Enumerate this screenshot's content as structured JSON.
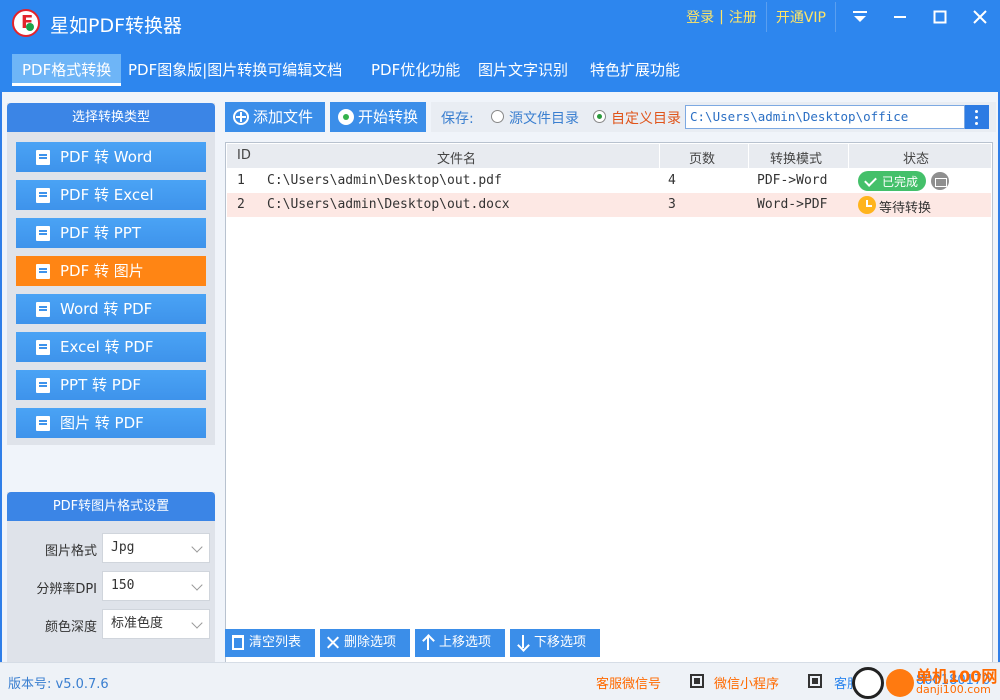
{
  "app": {
    "title": "星如PDF转换器"
  },
  "topbar": {
    "login": "登录",
    "sep": "|",
    "register": "注册",
    "vip": "开通VIP"
  },
  "menu": [
    {
      "label": "PDF格式转换",
      "active": true
    },
    {
      "label": "PDF图象版|图片转换可编辑文档",
      "active": false
    },
    {
      "label": "PDF优化功能",
      "active": false
    },
    {
      "label": "图片文字识别",
      "active": false
    },
    {
      "label": "特色扩展功能",
      "active": false
    }
  ],
  "sidebar": {
    "header": "选择转换类型",
    "items": [
      {
        "label": "PDF 转 Word",
        "selected": false
      },
      {
        "label": "PDF 转 Excel",
        "selected": false
      },
      {
        "label": "PDF 转 PPT",
        "selected": false
      },
      {
        "label": "PDF 转 图片",
        "selected": true
      },
      {
        "label": "Word 转 PDF",
        "selected": false
      },
      {
        "label": "Excel 转 PDF",
        "selected": false
      },
      {
        "label": "PPT  转 PDF",
        "selected": false
      },
      {
        "label": "图片 转 PDF",
        "selected": false
      }
    ]
  },
  "settings": {
    "header": "PDF转图片格式设置",
    "rows": [
      {
        "label": "图片格式",
        "value": "Jpg"
      },
      {
        "label": "分辨率DPI",
        "value": "150"
      },
      {
        "label": "颜色深度",
        "value": "标准色度"
      }
    ]
  },
  "toolbar": {
    "add_file": "添加文件",
    "start": "开始转换",
    "save_label": "保存:",
    "opt_source": "源文件目录",
    "opt_custom": "自定义目录",
    "selected_option": "自定义目录",
    "path_value": "C:\\Users\\admin\\Desktop\\office"
  },
  "table": {
    "headers": [
      "ID",
      "文件名",
      "页数",
      "转换模式",
      "状态"
    ],
    "rows": [
      {
        "id": "1",
        "file": "C:\\Users\\admin\\Desktop\\out.pdf",
        "pages": "4",
        "mode": "PDF->Word",
        "status": "已完成"
      },
      {
        "id": "2",
        "file": "C:\\Users\\admin\\Desktop\\out.docx",
        "pages": "3",
        "mode": "Word->PDF",
        "status": "等待转换"
      }
    ]
  },
  "actions": {
    "clear": "清空列表",
    "delete": "删除选项",
    "up": "上移选项",
    "down": "下移选项"
  },
  "status": {
    "version": "版本号: v5.0.7.6",
    "wechat": "客服微信号",
    "mini": "微信小程序",
    "qq": "客服",
    "phone": "800180170",
    "watermark_main": "单机100网",
    "watermark_sub": "danji100.com"
  },
  "colors": {
    "brand": "#2d86ee",
    "accent": "#ff8514",
    "done": "#44c06a",
    "waiting": "#ffb41d"
  }
}
